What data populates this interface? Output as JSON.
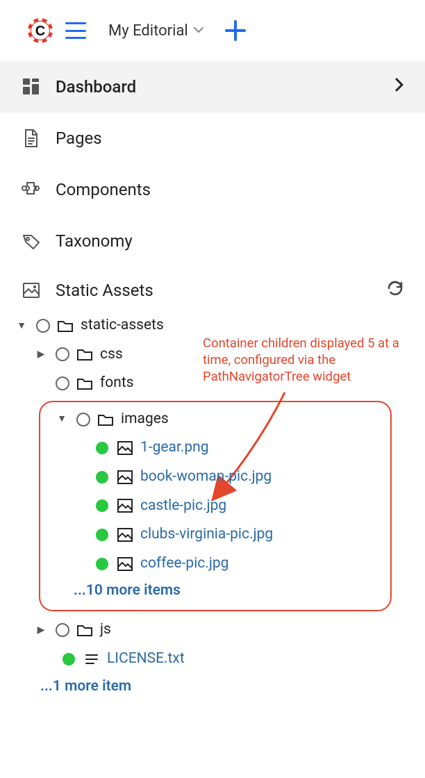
{
  "header": {
    "site_label": "My Editorial"
  },
  "nav": {
    "dashboard": "Dashboard",
    "pages": "Pages",
    "components": "Components",
    "taxonomy": "Taxonomy",
    "static_assets": "Static Assets"
  },
  "tree": {
    "root": "static-assets",
    "folders": {
      "css": "css",
      "fonts": "fonts",
      "images": "images",
      "js": "js"
    },
    "images_files": [
      "1-gear.png",
      "book-woman-pic.jpg",
      "castle-pic.jpg",
      "clubs-virginia-pic.jpg",
      "coffee-pic.jpg"
    ],
    "images_more": "...10 more items",
    "license": "LICENSE.txt",
    "root_more": "...1 more item"
  },
  "callout": {
    "text": "Container children displayed 5 at a time, configured via the PathNavigatorTree widget"
  }
}
